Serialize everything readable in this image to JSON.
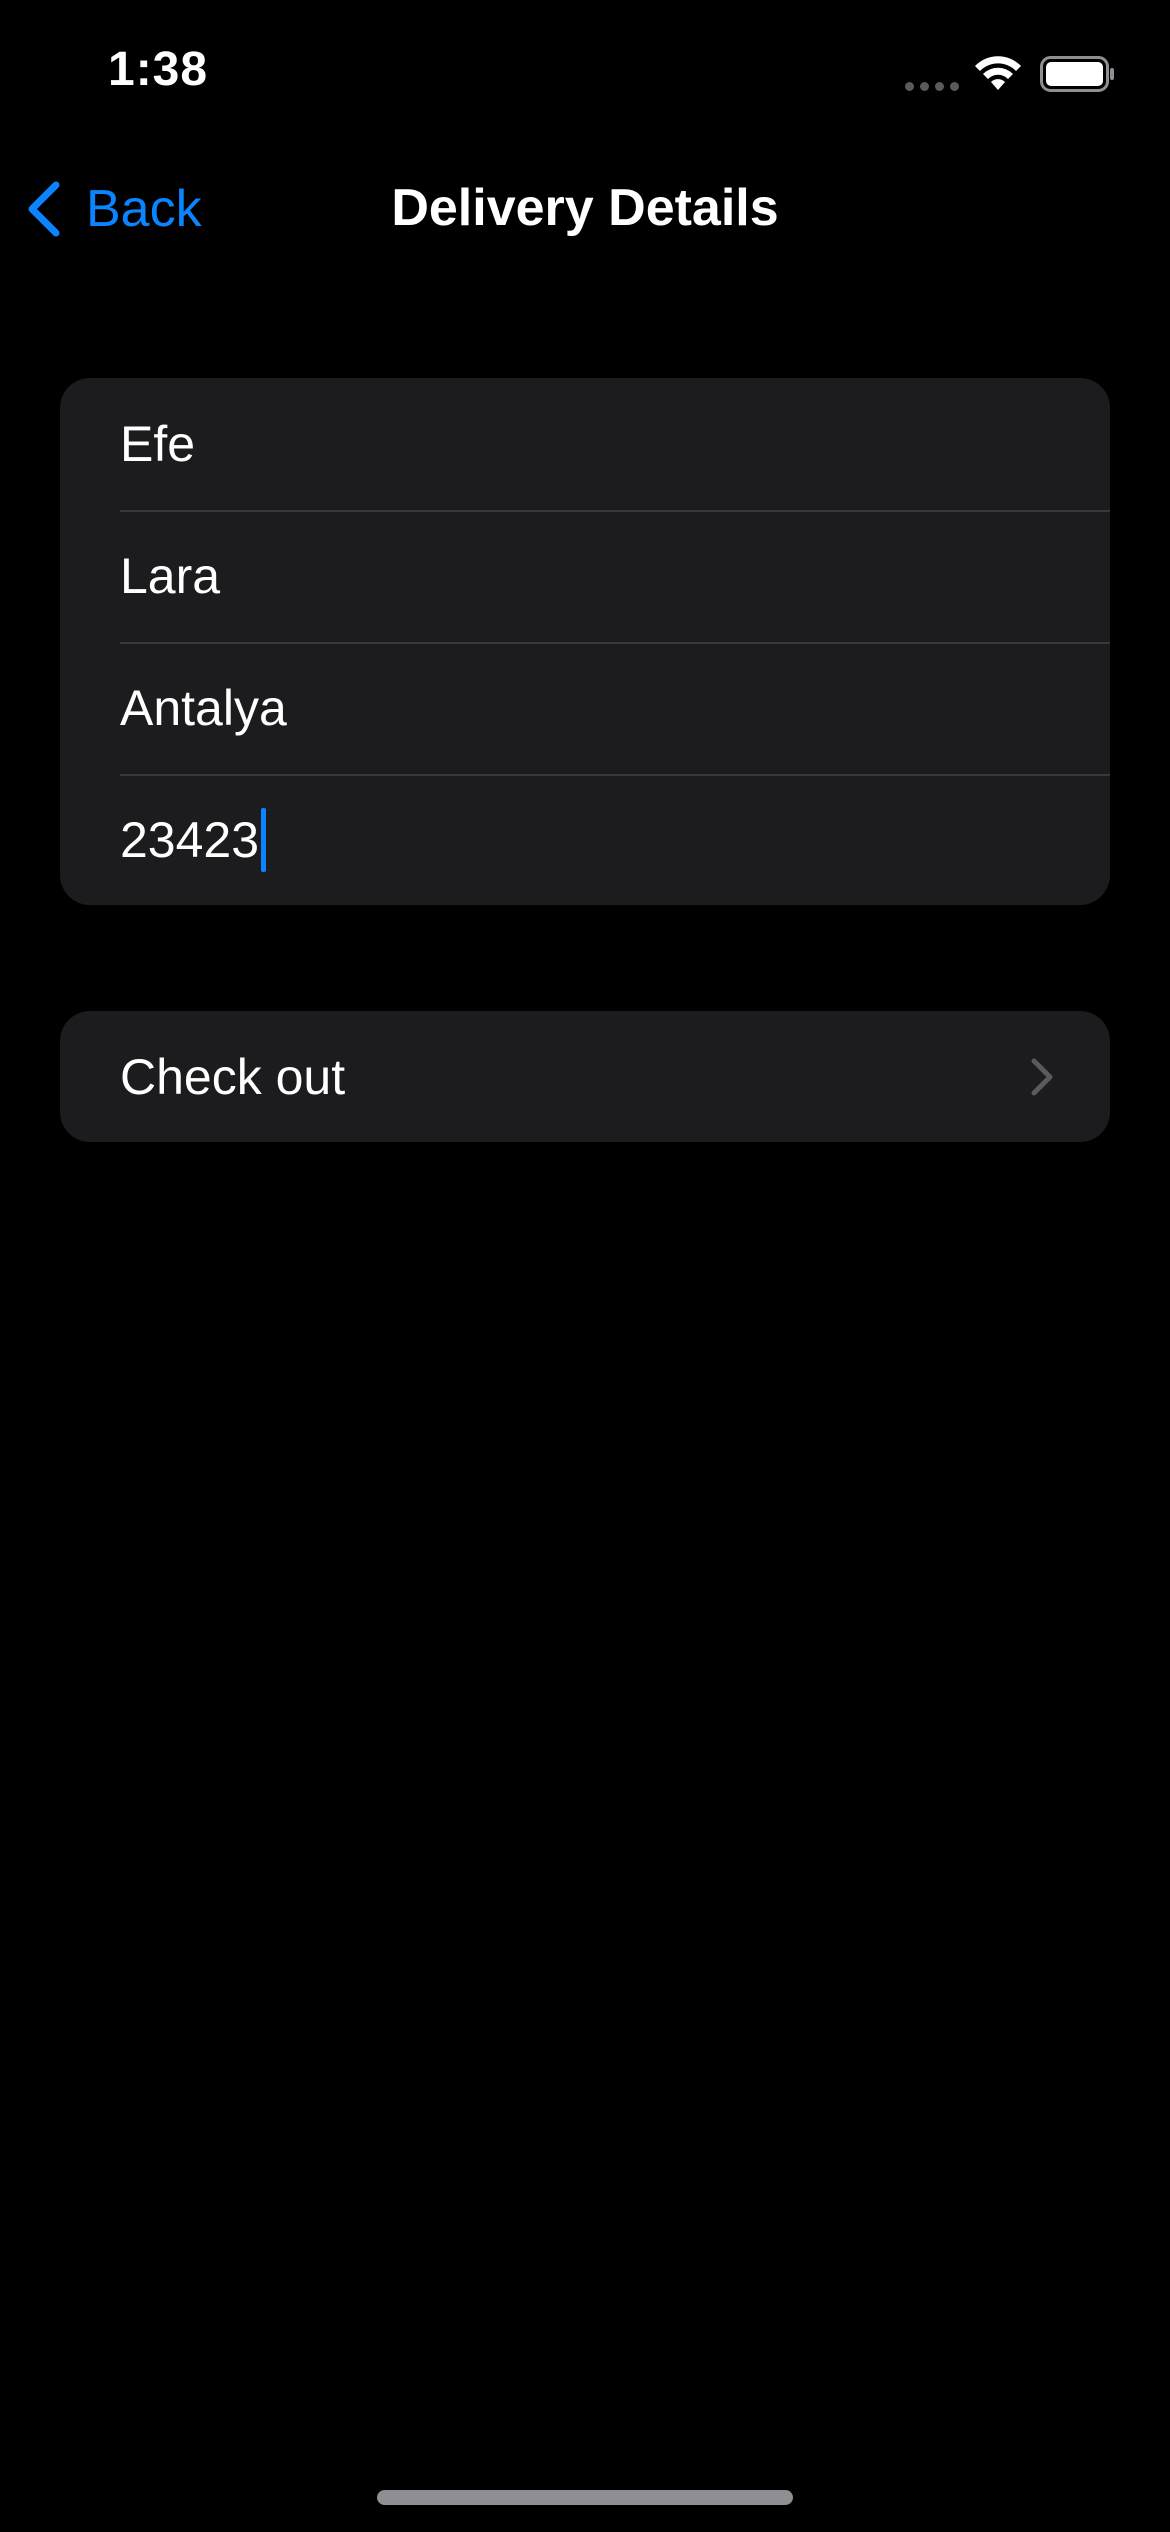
{
  "status_bar": {
    "time": "1:38",
    "wifi_icon": "wifi-icon",
    "battery_icon": "battery-icon",
    "signal_icon": "cellular-signal-icon"
  },
  "nav": {
    "back_label": "Back",
    "back_icon": "chevron-left-icon",
    "title": "Delivery Details"
  },
  "form": {
    "fields": [
      {
        "value": "Efe"
      },
      {
        "value": "Lara"
      },
      {
        "value": "Antalya"
      },
      {
        "value": "23423"
      }
    ]
  },
  "checkout": {
    "label": "Check out",
    "icon": "chevron-right-icon"
  },
  "colors": {
    "background": "#000000",
    "cell_background": "#1c1c1e",
    "separator": "#38383a",
    "accent": "#0a84ff",
    "text": "#ffffff",
    "chevron": "#5a5a5e"
  }
}
